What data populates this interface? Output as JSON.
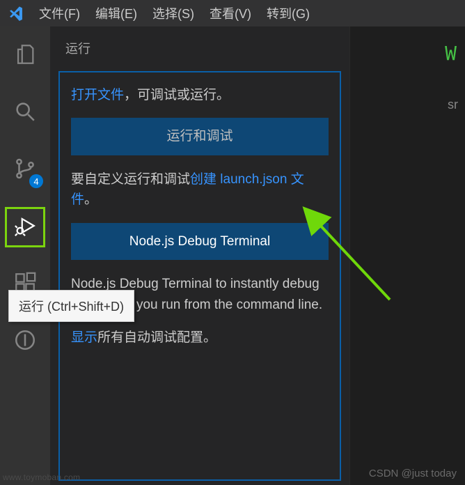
{
  "menubar": {
    "file": "文件(F)",
    "edit": "编辑(E)",
    "select": "选择(S)",
    "view": "查看(V)",
    "go": "转到(G)"
  },
  "activitybar": {
    "scm_badge": "4"
  },
  "sidebar": {
    "title": "运行",
    "open_file_link": "打开文件",
    "open_file_trail": "，可调试或运行。",
    "run_and_debug_btn": "运行和调试",
    "customize_lead": "要自定义运行和调试",
    "create_launch_link": "创建 launch.json 文件",
    "customize_tail": "。",
    "node_terminal_btn": "Node.js Debug Terminal",
    "node_terminal_desc_head": " Node.js Debug Terminal to instantly debug JavaScript you run from the command line.",
    "show_link": "显示",
    "show_tail": "所有自动调试配置。"
  },
  "tooltip": {
    "text": "运行 (Ctrl+Shift+D)"
  },
  "right": {
    "accent_glyph": "W",
    "partial_text": "sr"
  },
  "watermark_left": "www.toymoban.com",
  "watermark": "CSDN @just today"
}
